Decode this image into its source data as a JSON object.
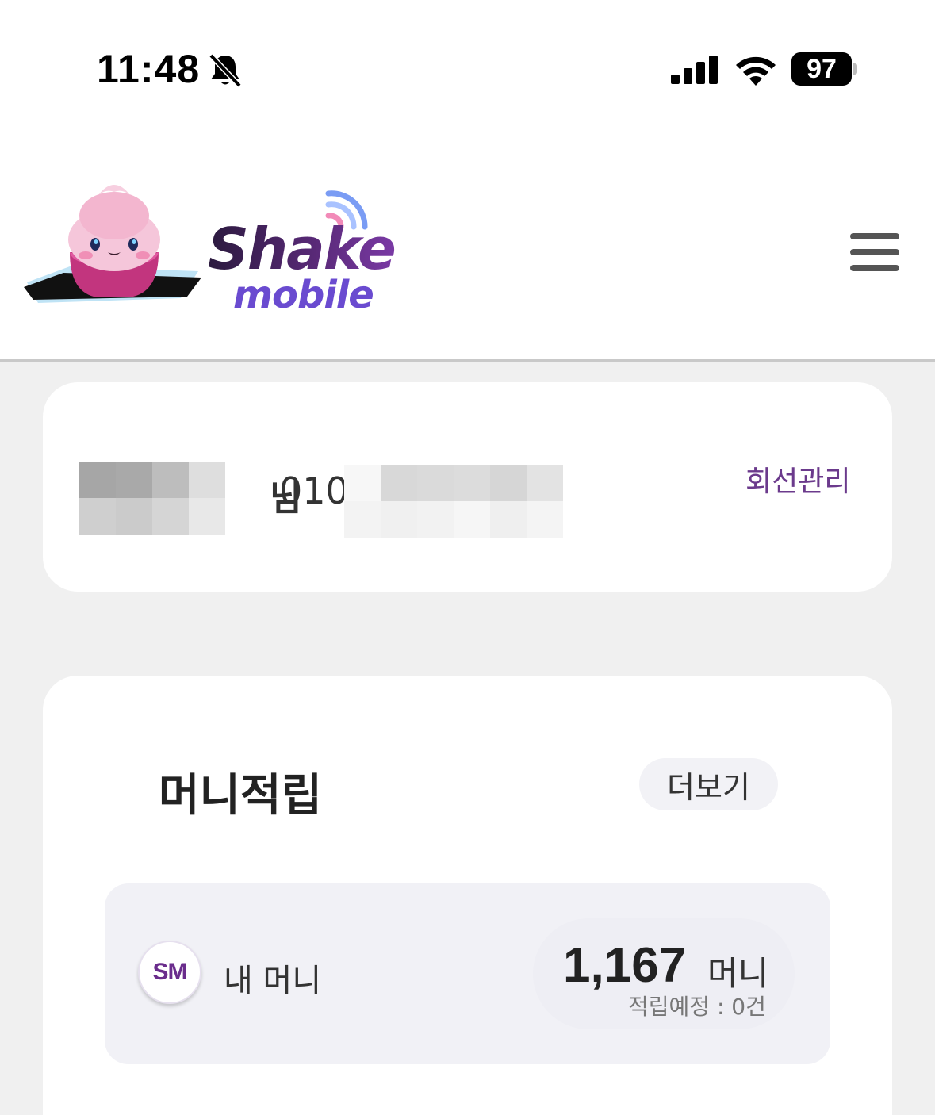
{
  "status_bar": {
    "time": "11:48",
    "battery": "97",
    "icons": [
      "bell-slash-icon",
      "cellular-signal-icon",
      "wifi-icon",
      "battery-icon"
    ]
  },
  "header": {
    "logo_word_1": "Shake",
    "logo_word_2": "mobile",
    "menu_icon": "hamburger-menu-icon"
  },
  "user_card": {
    "name_suffix": "님",
    "phone_prefix": "010",
    "line_manage_label": "회선관리"
  },
  "money_card": {
    "title": "머니적립",
    "more_label": "더보기",
    "avatar_text": "SM",
    "my_money_label": "내 머니",
    "amount": "1,167",
    "amount_unit": "머니",
    "pending_text": "적립예정 : 0건"
  },
  "colors": {
    "accent_purple": "#6b3a8c",
    "background": "#f0f0f0",
    "card": "#ffffff"
  }
}
